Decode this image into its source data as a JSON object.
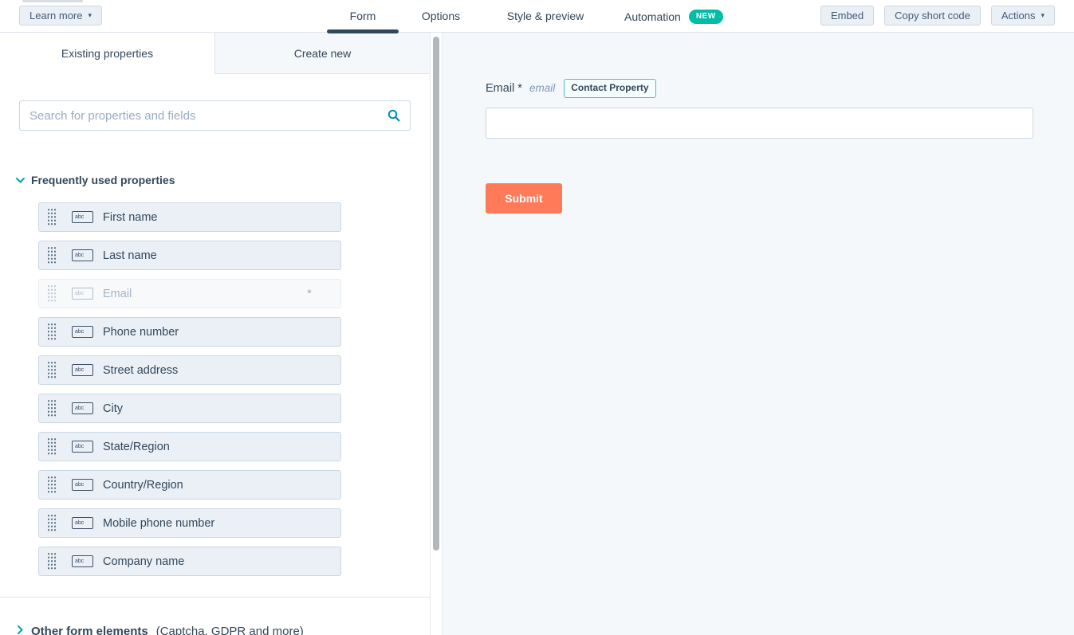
{
  "header": {
    "learn_more_label": "Learn more",
    "tabs": [
      {
        "label": "Form",
        "active": true
      },
      {
        "label": "Options",
        "active": false
      },
      {
        "label": "Style & preview",
        "active": false
      },
      {
        "label": "Automation",
        "active": false,
        "badge": "NEW"
      }
    ],
    "actions": [
      {
        "label": "Embed"
      },
      {
        "label": "Copy short code"
      },
      {
        "label": "Actions"
      }
    ]
  },
  "left_panel": {
    "tabs": [
      {
        "label": "Existing properties",
        "active": true
      },
      {
        "label": "Create new",
        "active": false
      }
    ],
    "search": {
      "placeholder": "Search for properties and fields"
    },
    "section_title": "Frequently used properties",
    "properties": [
      {
        "label": "First name",
        "disabled": false
      },
      {
        "label": "Last name",
        "disabled": false
      },
      {
        "label": "Email",
        "disabled": true,
        "required_marker": "*"
      },
      {
        "label": "Phone number",
        "disabled": false
      },
      {
        "label": "Street address",
        "disabled": false
      },
      {
        "label": "City",
        "disabled": false
      },
      {
        "label": "State/Region",
        "disabled": false
      },
      {
        "label": "Country/Region",
        "disabled": false
      },
      {
        "label": "Mobile phone number",
        "disabled": false
      },
      {
        "label": "Company name",
        "disabled": false
      }
    ],
    "footer": {
      "title": "Other form elements",
      "subtitle": "(Captcha, GDPR and more)"
    }
  },
  "form_preview": {
    "field": {
      "label": "Email",
      "required_marker": "*",
      "internal_name": "email",
      "badge": "Contact Property",
      "value": ""
    },
    "submit_label": "Submit"
  },
  "icons": {
    "text_field_glyph": "abc"
  },
  "colors": {
    "primary_text": "#33475b",
    "accent_teal": "#00bda5",
    "icon_teal": "#0091ae",
    "chevron_teal": "#00a4bd",
    "button_bg": "#eaf0f6",
    "button_border": "#cbd6e2",
    "item_bg": "#eaf0f6",
    "panel_bg": "#f5f8fa",
    "submit_orange": "#ff7a59",
    "placeholder_gray": "#99acc2"
  }
}
